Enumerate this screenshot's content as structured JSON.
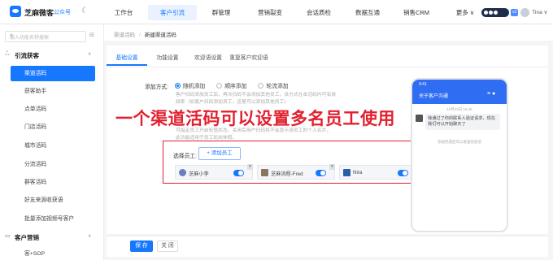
{
  "brand": {
    "name": "芝麻微客",
    "sub": "公众号"
  },
  "topnav": [
    "工作台",
    "客户引流",
    "群管理",
    "营销裂变",
    "会话质检",
    "数据互通",
    "销售CRM",
    "更多 ∨"
  ],
  "topnav_active": "客户引流",
  "user": {
    "tag": "v3",
    "name": "Tina ∨"
  },
  "sidebar": {
    "search_placeholder": "输入功能名称搜索",
    "group1": "引流获客",
    "items": [
      "渠道活码",
      "获客助手",
      "点单活码",
      "门店活码",
      "城市活码",
      "分流活码",
      "群客活码",
      "好友来源收获语",
      "批量添加视频号客户"
    ],
    "active_item": "渠道活码",
    "group2": "客户营销",
    "cut_item": "客+SOP"
  },
  "breadcrumb": {
    "parent": "渠道活码",
    "current": "新建渠道活码"
  },
  "tabs": [
    "基础设置",
    "功能设置",
    "欢迎语设置",
    "重复客户欢迎语"
  ],
  "active_tab": "基础设置",
  "form": {
    "mode_label": "添加方式:",
    "modes": [
      "随机添加",
      "顺序添加",
      "轮流添加"
    ],
    "mode_selected": "随机添加",
    "help1": "客户扫码添加员工后，再次扫码不会添加其他员工，该方式在本活码内可有效",
    "help2": "频率（如客户扫码添加员工，还是可以添加其他员工）",
    "help3": "可指定员工开启轮值状态，关闭后用户扫码将不会显示该员工的个人名片，",
    "help4": "此功能适用于员工轮岗休假。",
    "staff_label": "选择员工:",
    "add_staff": "+ 添加员工",
    "staff": [
      "芝麻小李",
      "芝麻流程-Fred",
      "Nira"
    ]
  },
  "overlay_caption": "一个渠道活码可以设置多名员工使用",
  "phone": {
    "time": "9:41",
    "title": "关于客户沟通",
    "date": "10月23日 16:45",
    "message": "我通过了你的联系人验证请求，现在我们可以开始聊天了",
    "note": "添加完成后可以发送欢迎语"
  },
  "buttons": {
    "save": "保 存",
    "close": "关 闭"
  },
  "colors": {
    "accent": "#1677ff",
    "highlight": "#e2202f"
  }
}
